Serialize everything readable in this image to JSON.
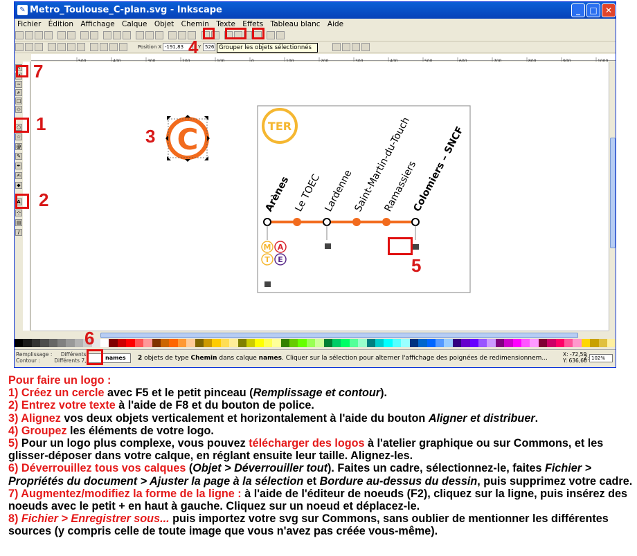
{
  "window": {
    "title": "Metro_Toulouse_C-plan.svg - Inkscape",
    "app_icon": "inkscape-icon"
  },
  "menu": [
    "Fichier",
    "Édition",
    "Affichage",
    "Calque",
    "Objet",
    "Chemin",
    "Texte",
    "Effets",
    "Tableau blanc",
    "Aide"
  ],
  "toolbar2": {
    "pos_label": "Position X",
    "x_value": "-191,83",
    "y_label": "Y",
    "y_value": "526"
  },
  "tooltip": "Grouper les objets sélectionnés",
  "ruler_labels": [
    "500",
    "400",
    "300",
    "200",
    "100",
    "0",
    "100",
    "200",
    "300",
    "400",
    "500",
    "600",
    "700",
    "800",
    "900",
    "1000"
  ],
  "logo": {
    "letter": "C",
    "color": "#f26b1d"
  },
  "map": {
    "ter_label": "TER",
    "stations": [
      "Arènes",
      "Le TOEC",
      "Lardenne",
      "Saint-Martin-du-Touch",
      "Ramassiers",
      "Colomiers – SNCF"
    ],
    "line_color": "#f26b1d",
    "ter_color": "#f5b731",
    "connections": [
      "M",
      "A",
      "T",
      "E"
    ]
  },
  "markers": [
    "7",
    "1",
    "2",
    "3",
    "4",
    "5",
    "6"
  ],
  "status": {
    "fill_label": "Remplissage :",
    "fill_value": "Différents",
    "stroke_label": "Contour :",
    "stroke_value": "Différents 7,89",
    "layer": "names",
    "msg_count": "2",
    "msg_a": " objets de type ",
    "msg_type": "Chemin",
    "msg_b": " dans calque ",
    "msg_layer": "names",
    "msg_c": ". Cliquer sur la sélection pour alterner l'affichage des poignées de redimensionnem...",
    "coord_x": "X:  -72,59",
    "coord_y": "Y:  636,66",
    "zoom_label": "Z:",
    "zoom": "102%"
  },
  "instructions": {
    "title": "Pour faire un logo :",
    "s1a": "1) Créez un cercle",
    "s1b": " avec F5 et le petit pinceau (",
    "s1c": "Remplissage et contour",
    "s1d": ").",
    "s2a": "2) Entrez votre texte",
    "s2b": " à l'aide de F8 et du bouton de police.",
    "s3a": "3) Alignez",
    "s3b": " vos deux objets verticalement et horizontalement à l'aide du bouton ",
    "s3c": "Aligner et distribuer",
    "s3d": ".",
    "s4a": "4) Groupez",
    "s4b": " les éléments de votre logo.",
    "s5a": "5)",
    "s5b": " Pour un logo plus complexe, vous pouvez ",
    "s5c": "télécharger des logos",
    "s5d": " à l'atelier graphique ou sur Commons, et les glisser-déposer dans votre calque, en réglant ensuite leur taille. Alignez-les.",
    "s6a": "6) Déverrouillez tous vos calques",
    "s6b": " (",
    "s6c": "Objet > Déverrouiller tout",
    "s6d": "). Faites un cadre, sélectionnez-le, faites ",
    "s6e": "Fichier > Propriétés du document > Ajuster la page à la sélection",
    "s6f": " et ",
    "s6g": "Bordure au-dessus du dessin",
    "s6h": ", puis supprimez votre cadre.",
    "s7a": "7) Augmentez/modifiez la forme de la ligne :",
    "s7b": " à l'aide de l'éditeur de noeuds (F2), cliquez sur la ligne, puis insérez des noeuds avec le petit + en haut à gauche. Cliquez sur un noeud et déplacez-le.",
    "s8a": "8) ",
    "s8b": "Fichier > Enregistrer sous...",
    "s8c": " puis importez votre svg sur Commons, sans oublier de mentionner les différentes sources (y compris celle de toute image que vous n'avez pas créée vous-même)."
  }
}
